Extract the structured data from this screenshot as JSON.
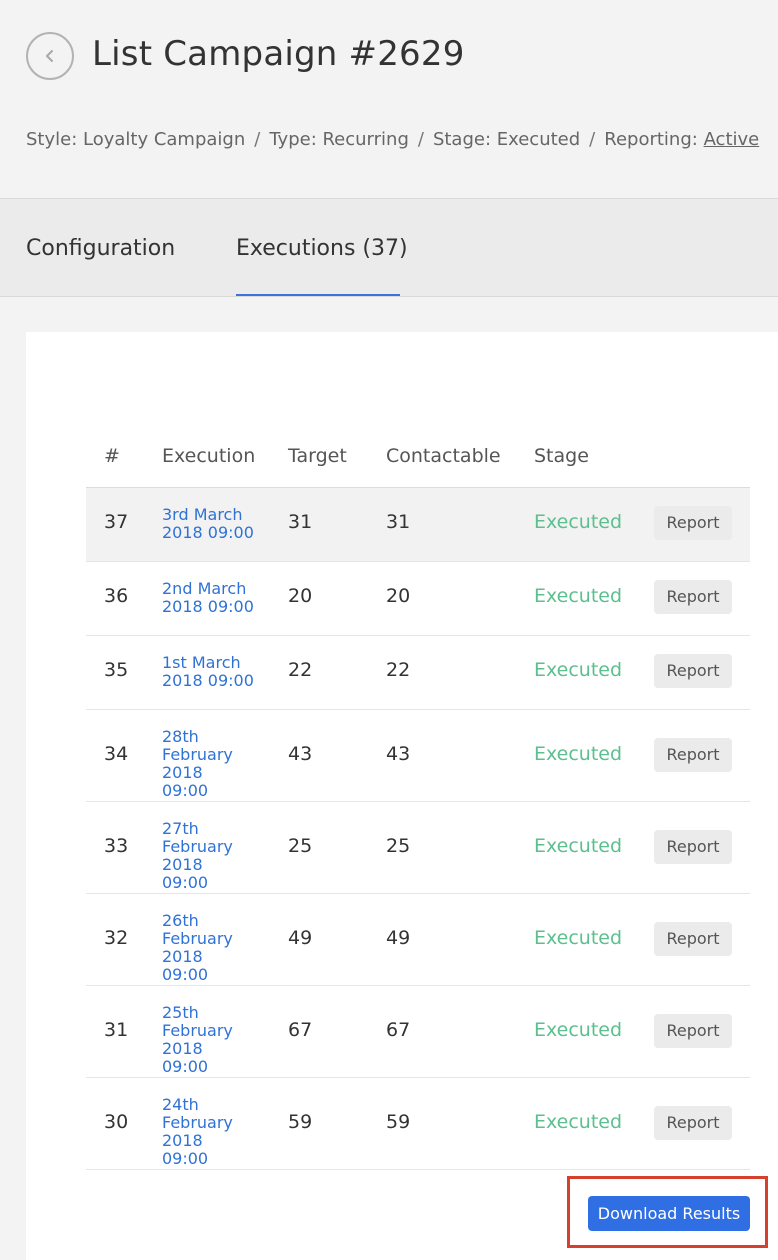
{
  "header": {
    "title": "List Campaign #2629",
    "meta": {
      "style": "Style: Loyalty Campaign",
      "type": "Type: Recurring",
      "stage": "Stage: Executed",
      "reporting_label": "Reporting:",
      "reporting_value": "Active",
      "separator": "/"
    }
  },
  "tabs": [
    {
      "label": "Configuration"
    },
    {
      "label": "Executions (37)"
    }
  ],
  "active_tab": "Executions (37)",
  "table": {
    "columns": [
      "#",
      "Execution",
      "Target",
      "Contactable",
      "Stage"
    ],
    "rows": [
      {
        "num": "37",
        "execution": "3rd March 2018 09:00",
        "target": "31",
        "contactable": "31",
        "stage": "Executed",
        "action": "Report"
      },
      {
        "num": "36",
        "execution": "2nd March 2018 09:00",
        "target": "20",
        "contactable": "20",
        "stage": "Executed",
        "action": "Report"
      },
      {
        "num": "35",
        "execution": "1st March 2018 09:00",
        "target": "22",
        "contactable": "22",
        "stage": "Executed",
        "action": "Report"
      },
      {
        "num": "34",
        "execution": "28th February 2018 09:00",
        "target": "43",
        "contactable": "43",
        "stage": "Executed",
        "action": "Report"
      },
      {
        "num": "33",
        "execution": "27th February 2018 09:00",
        "target": "25",
        "contactable": "25",
        "stage": "Executed",
        "action": "Report"
      },
      {
        "num": "32",
        "execution": "26th February 2018 09:00",
        "target": "49",
        "contactable": "49",
        "stage": "Executed",
        "action": "Report"
      },
      {
        "num": "31",
        "execution": "25th February 2018 09:00",
        "target": "67",
        "contactable": "67",
        "stage": "Executed",
        "action": "Report"
      },
      {
        "num": "30",
        "execution": "24th February 2018 09:00",
        "target": "59",
        "contactable": "59",
        "stage": "Executed",
        "action": "Report"
      }
    ]
  },
  "download_button": "Download Results",
  "colors": {
    "accent": "#2f6fe3",
    "link": "#2f72d6",
    "status_executed": "#5cbf8e",
    "highlight_box": "#d6402f"
  },
  "icons": {
    "back": "chevron-left-icon"
  }
}
